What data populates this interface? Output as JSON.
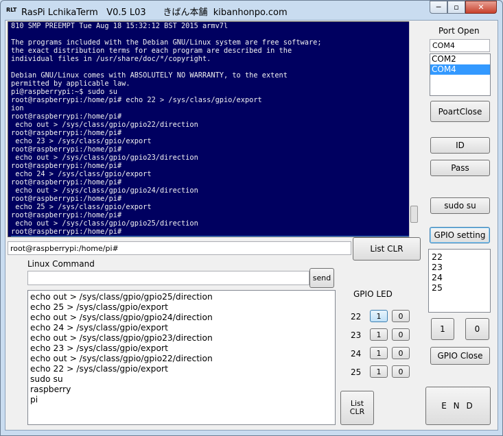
{
  "window": {
    "icon_text": "RLT",
    "title": "RasPi LchikaTerm   V0.5 L03      きばん本舗  kibanhonpo.com",
    "minimize_glyph": "─",
    "maximize_glyph": "▫",
    "close_glyph": "✕"
  },
  "terminal": {
    "lines": [
      "810 SMP PREEMPT Tue Aug 18 15:32:12 BST 2015 armv7l",
      "",
      "The programs included with the Debian GNU/Linux system are free software;",
      "the exact distribution terms for each program are described in the",
      "individual files in /usr/share/doc/*/copyright.",
      "",
      "Debian GNU/Linux comes with ABSOLUTELY NO WARRANTY, to the extent",
      "permitted by applicable law.",
      "pi@raspberrypi:~$ sudo su",
      "root@raspberrypi:/home/pi# echo 22 > /sys/class/gpio/export",
      "ion",
      "root@raspberrypi:/home/pi#",
      " echo out > /sys/class/gpio/gpio22/direction",
      "root@raspberrypi:/home/pi#",
      " echo 23 > /sys/class/gpio/export",
      "root@raspberrypi:/home/pi#",
      " echo out > /sys/class/gpio/gpio23/direction",
      "root@raspberrypi:/home/pi#",
      " echo 24 > /sys/class/gpio/export",
      "root@raspberrypi:/home/pi#",
      " echo out > /sys/class/gpio/gpio24/direction",
      "root@raspberrypi:/home/pi#",
      " echo 25 > /sys/class/gpio/export",
      "root@raspberrypi:/home/pi#",
      " echo out > /sys/class/gpio/gpio25/direction",
      "root@raspberrypi:/home/pi#"
    ],
    "selected_line": "root@raspberrypi:/home/pi#"
  },
  "prompt_field": "root@raspberrypi:/home/pi#",
  "buttons": {
    "list_clr_top": "List CLR",
    "send": "send",
    "list_clr_bottom_1": "List",
    "list_clr_bottom_2": "CLR",
    "port_close": "PoartClose",
    "id": "ID",
    "pass": "Pass",
    "sudo": "sudo su",
    "gpio_setting": "GPIO setting",
    "one": "1",
    "zero": "0",
    "gpio_close": "GPIO Close",
    "end": "E N D"
  },
  "linux_command": {
    "label": "Linux Command",
    "value": ""
  },
  "history": [
    "echo out > /sys/class/gpio/gpio25/direction",
    "echo 25 > /sys/class/gpio/export",
    "echo out > /sys/class/gpio/gpio24/direction",
    "echo 24 > /sys/class/gpio/export",
    "echo out > /sys/class/gpio/gpio23/direction",
    "echo 23 > /sys/class/gpio/export",
    "echo out > /sys/class/gpio/gpio22/direction",
    "echo 22 > /sys/class/gpio/export",
    "sudo su",
    "raspberry",
    "pi"
  ],
  "gpio_led": {
    "label": "GPIO LED",
    "pins": [
      {
        "pin": "22",
        "on": "1",
        "off": "0",
        "on_active": true
      },
      {
        "pin": "23",
        "on": "1",
        "off": "0",
        "on_active": false
      },
      {
        "pin": "24",
        "on": "1",
        "off": "0",
        "on_active": false
      },
      {
        "pin": "25",
        "on": "1",
        "off": "0",
        "on_active": false
      }
    ]
  },
  "port": {
    "label": "Port Open",
    "value": "COM4",
    "options": [
      "COM2",
      "COM4"
    ],
    "selected": "COM4"
  },
  "gpio_list": [
    "22",
    "23",
    "24",
    "25"
  ]
}
